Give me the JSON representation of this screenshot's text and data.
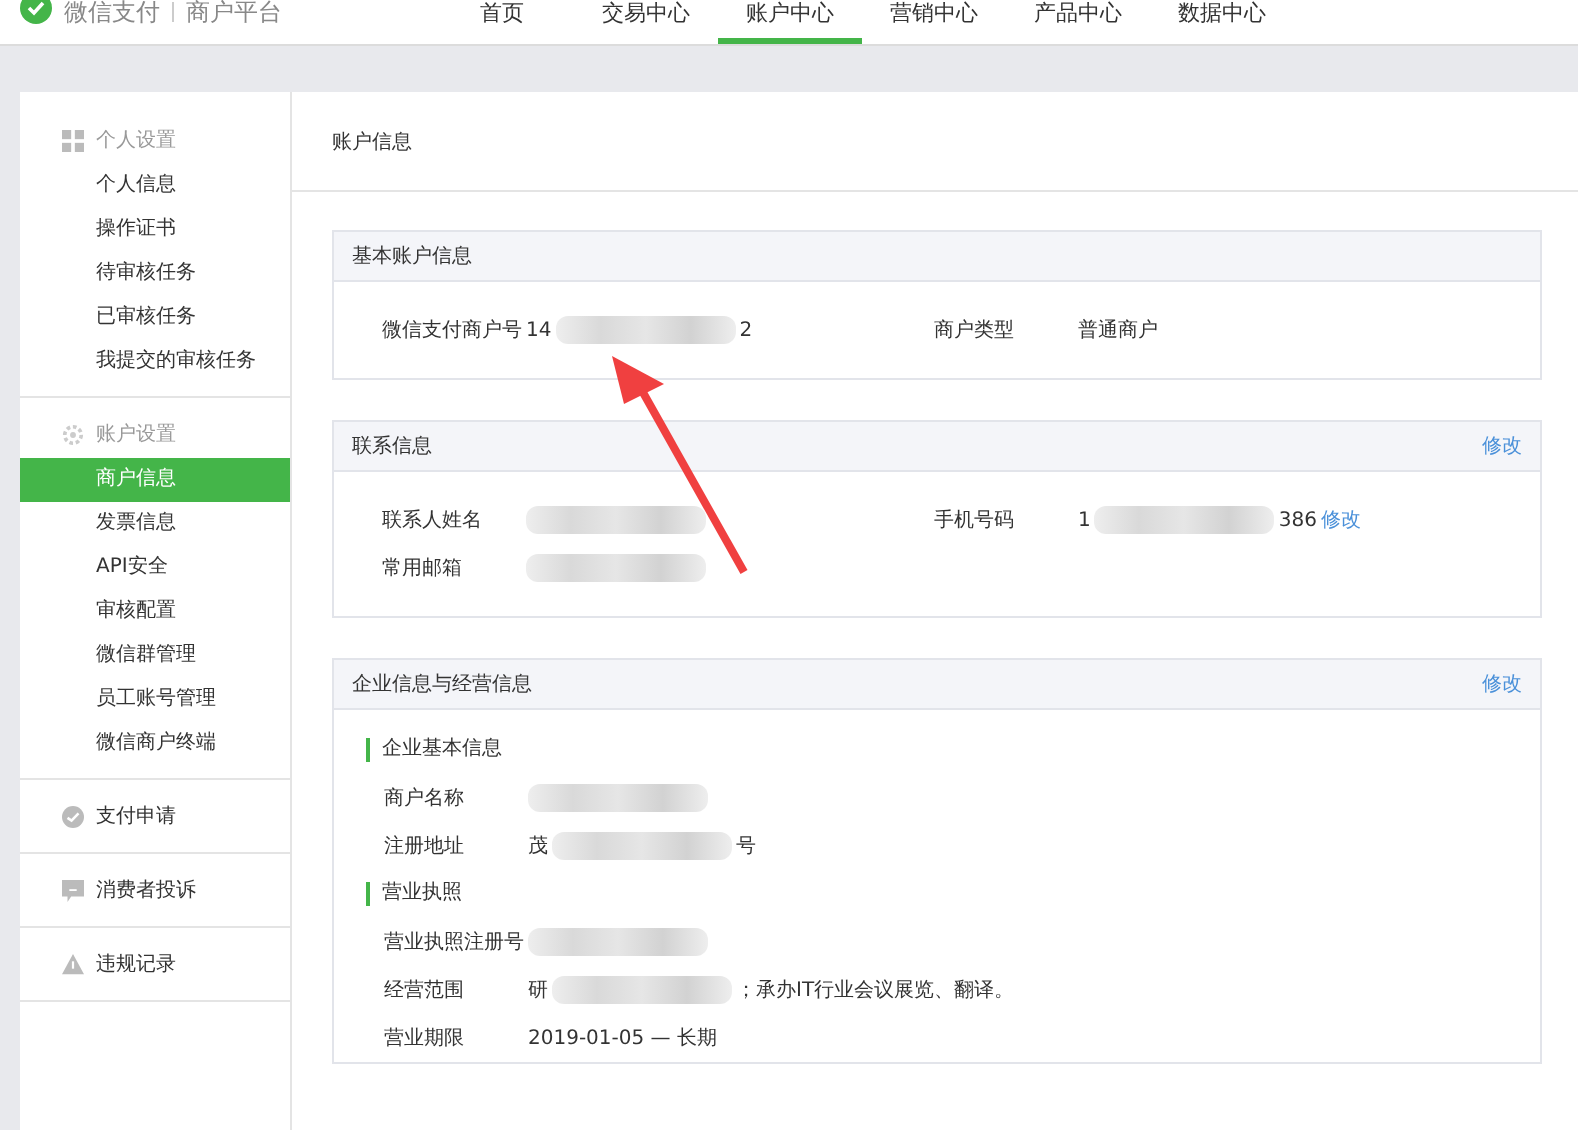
{
  "header": {
    "brand": "微信支付",
    "product": "商户平台",
    "nav": [
      {
        "label": "首页",
        "selected": false
      },
      {
        "label": "交易中心",
        "selected": false
      },
      {
        "label": "账户中心",
        "selected": true
      },
      {
        "label": "营销中心",
        "selected": false
      },
      {
        "label": "产品中心",
        "selected": false
      },
      {
        "label": "数据中心",
        "selected": false
      }
    ]
  },
  "sidebar": {
    "groups": [
      {
        "title": "个人设置",
        "kind": "header",
        "items": [
          {
            "label": "个人信息",
            "selected": false
          },
          {
            "label": "操作证书",
            "selected": false
          },
          {
            "label": "待审核任务",
            "selected": false
          },
          {
            "label": "已审核任务",
            "selected": false
          },
          {
            "label": "我提交的审核任务",
            "selected": false
          }
        ]
      },
      {
        "title": "账户设置",
        "kind": "header",
        "items": [
          {
            "label": "商户信息",
            "selected": true
          },
          {
            "label": "发票信息",
            "selected": false
          },
          {
            "label": "API安全",
            "selected": false
          },
          {
            "label": "审核配置",
            "selected": false
          },
          {
            "label": "微信群管理",
            "selected": false
          },
          {
            "label": "员工账号管理",
            "selected": false
          },
          {
            "label": "微信商户终端",
            "selected": false
          }
        ]
      },
      {
        "title": "支付申请",
        "kind": "link"
      },
      {
        "title": "消费者投诉",
        "kind": "link"
      },
      {
        "title": "违规记录",
        "kind": "link"
      }
    ]
  },
  "page_title": "账户信息",
  "sections": [
    {
      "title": "基本账户信息",
      "rows": [
        [
          {
            "label": "微信支付商户号",
            "value": [
              {
                "kind": "text",
                "text": "14"
              },
              {
                "kind": "redacted"
              },
              {
                "kind": "text",
                "text": "2"
              }
            ]
          },
          {
            "label": "商户类型",
            "value": [
              {
                "kind": "text",
                "text": "普通商户"
              }
            ]
          }
        ]
      ]
    },
    {
      "title": "联系信息",
      "action": "修改",
      "rows": [
        [
          {
            "label": "联系人姓名",
            "value": [
              {
                "kind": "redacted"
              }
            ]
          },
          {
            "label": "手机号码",
            "value": [
              {
                "kind": "text",
                "text": "1"
              },
              {
                "kind": "redacted"
              },
              {
                "kind": "text",
                "text": "386"
              },
              {
                "kind": "link",
                "text": "修改"
              }
            ]
          }
        ],
        [
          {
            "label": "常用邮箱",
            "value": [
              {
                "kind": "redacted"
              }
            ]
          }
        ]
      ]
    },
    {
      "title": "企业信息与经营信息",
      "action": "修改",
      "groups": [
        {
          "title": "企业基本信息",
          "fields": [
            {
              "label": "商户名称",
              "value": [
                {
                  "kind": "redacted"
                }
              ]
            },
            {
              "label": "注册地址",
              "value": [
                {
                  "kind": "text",
                  "text": "茂"
                },
                {
                  "kind": "redacted"
                },
                {
                  "kind": "text",
                  "text": "号"
                }
              ]
            }
          ]
        },
        {
          "title": "营业执照",
          "fields": [
            {
              "label": "营业执照注册号",
              "value": [
                {
                  "kind": "redacted"
                }
              ]
            },
            {
              "label": "经营范围",
              "value": [
                {
                  "kind": "text",
                  "text": "研"
                },
                {
                  "kind": "redacted"
                },
                {
                  "kind": "text",
                  "text": "；承办IT行业会议展览、翻译。"
                }
              ]
            },
            {
              "label": "营业期限",
              "value": [
                {
                  "kind": "text",
                  "text": "2019-01-05 — 长期"
                }
              ]
            }
          ]
        }
      ]
    }
  ]
}
